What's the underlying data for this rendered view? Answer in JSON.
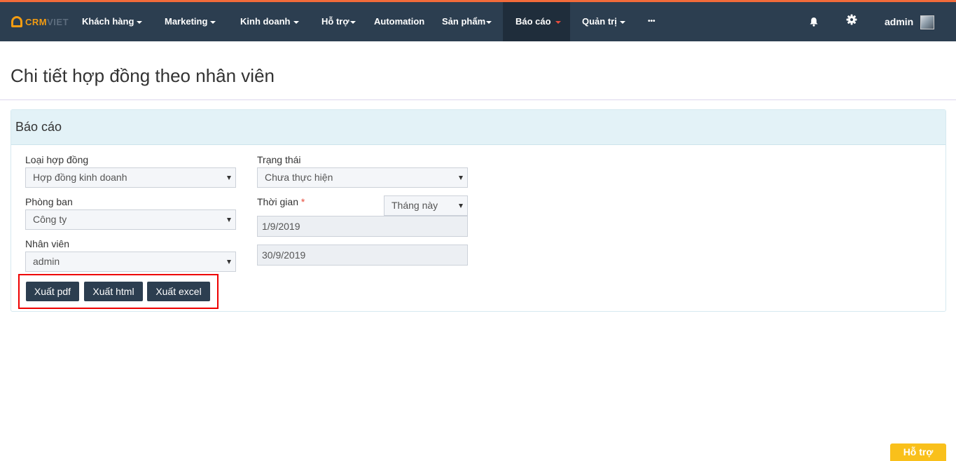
{
  "brand": {
    "logo_crm": "CRM",
    "logo_viet": "VIET"
  },
  "nav": {
    "items": [
      {
        "label": "Khách hàng"
      },
      {
        "label": "Marketing"
      },
      {
        "label": "Kinh doanh"
      },
      {
        "label": "Hỗ trợ"
      },
      {
        "label": "Automation"
      },
      {
        "label": "Sản phẩm"
      },
      {
        "label": "Báo cáo"
      },
      {
        "label": "Quản trị"
      },
      {
        "label": "•••"
      }
    ],
    "user": "admin",
    "icons": [
      "bell-icon",
      "gear-icon",
      "avatar"
    ]
  },
  "page": {
    "title": "Chi tiết hợp đồng theo nhân viên"
  },
  "panel": {
    "title": "Báo cáo",
    "fields": {
      "contract_type": {
        "label": "Loại hợp đồng",
        "value": "Hợp đồng kinh doanh"
      },
      "status": {
        "label": "Trạng thái",
        "value": "Chưa thực hiện"
      },
      "department": {
        "label": "Phòng ban",
        "value": "Công ty"
      },
      "time": {
        "label": "Thời gian",
        "required_mark": "*",
        "period": "Tháng này",
        "from": "1/9/2019",
        "to": "30/9/2019"
      },
      "employee": {
        "label": "Nhân viên",
        "value": "admin"
      }
    },
    "buttons": {
      "pdf": "Xuất pdf",
      "html": "Xuất html",
      "excel": "Xuất excel"
    }
  },
  "support_button": "Hỗ trợ",
  "colors": {
    "navbar": "#2c3e50",
    "accent": "#f26b3a",
    "panel_heading": "#e3f2f7",
    "support": "#f9c01b"
  }
}
